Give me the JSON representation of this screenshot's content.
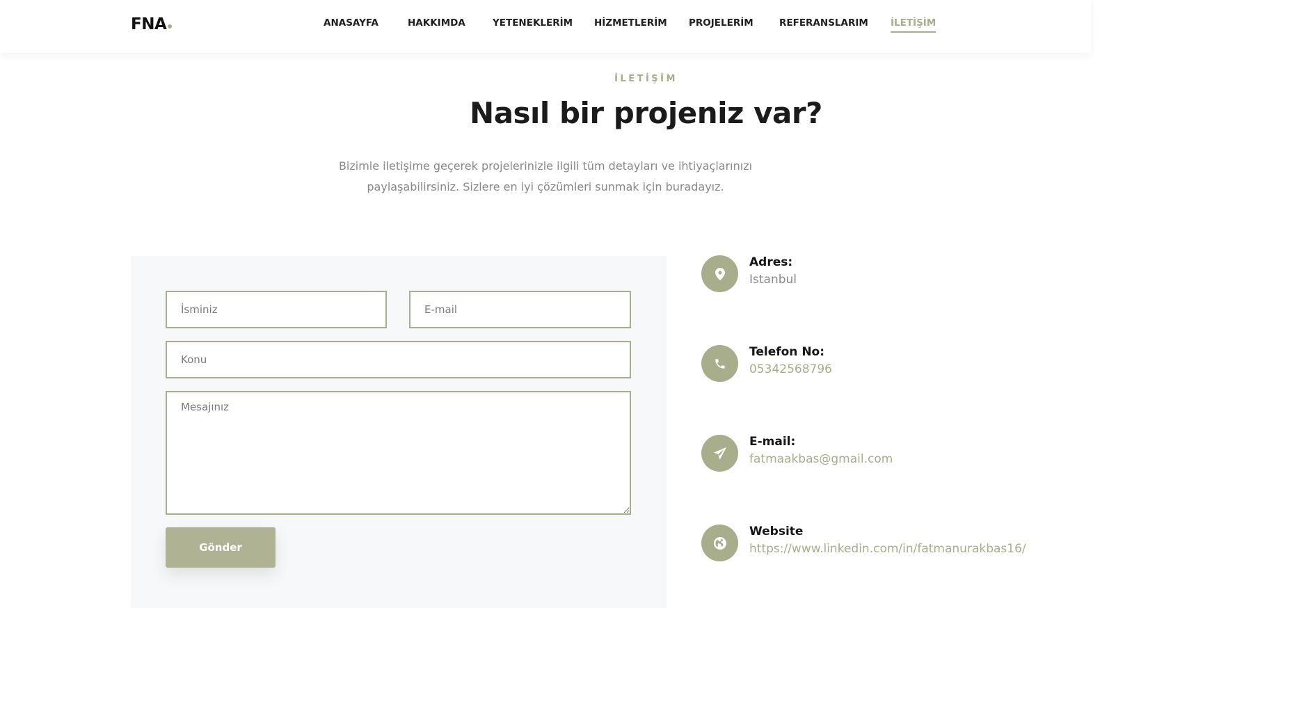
{
  "header": {
    "logo": "FNA",
    "nav": [
      {
        "label": "ANASAYFA"
      },
      {
        "label": "HAKKIMDA"
      },
      {
        "label": "YETENEKLERİM"
      },
      {
        "label": "HİZMETLERİM"
      },
      {
        "label": "PROJELERİM"
      },
      {
        "label": "REFERANSLARIM"
      },
      {
        "label": "İLETİŞİM",
        "active": true
      }
    ]
  },
  "section": {
    "eyebrow": "İLETİŞİM",
    "title": "Nasıl bir projeniz var?",
    "description_line1": "Bizimle iletişime geçerek projelerinizle ilgili tüm detayları ve ihtiyaçlarınızı",
    "description_line2": "paylaşabilirsiniz. Sizlere en iyi çözümleri sunmak için buradayız."
  },
  "form": {
    "name_placeholder": "İsminiz",
    "email_placeholder": "E-mail",
    "subject_placeholder": "Konu",
    "message_placeholder": "Mesajınız",
    "submit_label": "Gönder"
  },
  "contact": {
    "address": {
      "label": "Adres:",
      "value": "Istanbul",
      "icon": "map-pin-icon"
    },
    "phone": {
      "label": "Telefon No:",
      "value": "05342568796",
      "icon": "phone-icon"
    },
    "email": {
      "label": "E-mail:",
      "value": "fatmaakbas@gmail.com",
      "icon": "paper-plane-icon"
    },
    "website": {
      "label": "Website",
      "value": "https://www.linkedin.com/in/fatmanurakbas16/",
      "icon": "globe-icon"
    }
  },
  "colors": {
    "accent": "#a8ad8c",
    "button": "#afb393",
    "card_bg": "#f7f8fa"
  }
}
